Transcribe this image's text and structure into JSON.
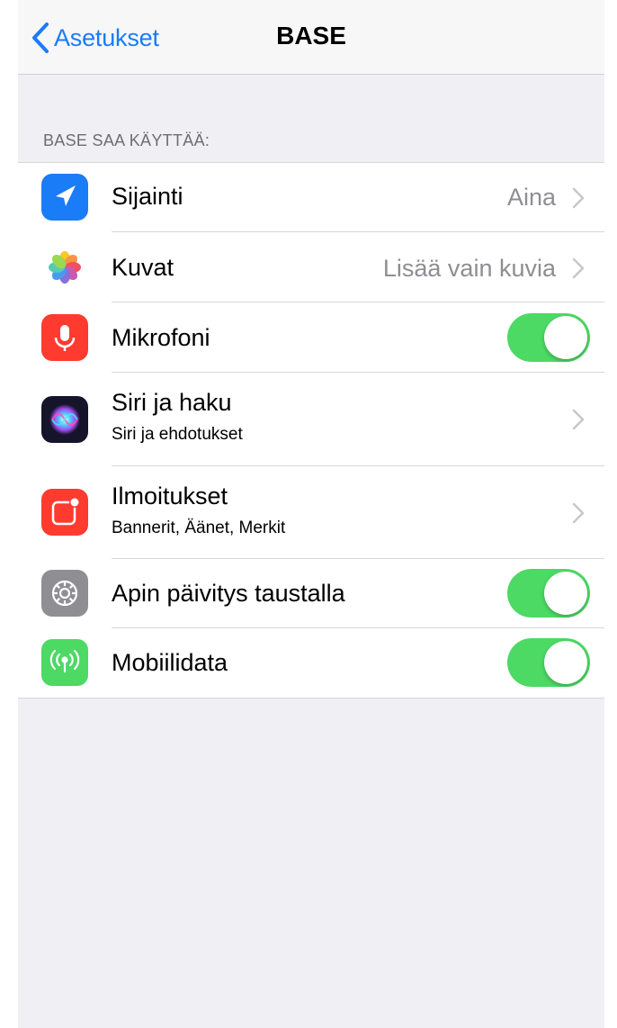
{
  "navbar": {
    "back_label": "Asetukset",
    "title": "BASE"
  },
  "section_header": "BASE SAA KÄYTTÄÄ:",
  "rows": [
    {
      "id": "location",
      "label": "Sijainti",
      "value": "Aina",
      "icon": "location-arrow-icon",
      "icon_color": "#1a7cf6",
      "control": "chevron"
    },
    {
      "id": "photos",
      "label": "Kuvat",
      "value": "Lisää vain kuvia",
      "icon": "photos-flower-icon",
      "control": "chevron"
    },
    {
      "id": "microphone",
      "label": "Mikrofoni",
      "icon": "microphone-icon",
      "icon_color": "#ff3b30",
      "control": "toggle",
      "enabled": true
    },
    {
      "id": "siri",
      "label": "Siri ja haku",
      "sublabel": "Siri ja ehdotukset",
      "icon": "siri-icon",
      "control": "chevron"
    },
    {
      "id": "notifications",
      "label": "Ilmoitukset",
      "sublabel": "Bannerit, Äänet, Merkit",
      "icon": "notifications-icon",
      "icon_color": "#ff3b30",
      "control": "chevron"
    },
    {
      "id": "background-refresh",
      "label": "Apin päivitys taustalla",
      "icon": "gear-icon",
      "icon_color": "#8e8e93",
      "control": "toggle",
      "enabled": true
    },
    {
      "id": "cellular",
      "label": "Mobiilidata",
      "icon": "antenna-icon",
      "icon_color": "#4cd964",
      "control": "toggle",
      "enabled": true
    }
  ],
  "colors": {
    "accent": "#1a7cf6",
    "toggle_on": "#4cd964"
  }
}
